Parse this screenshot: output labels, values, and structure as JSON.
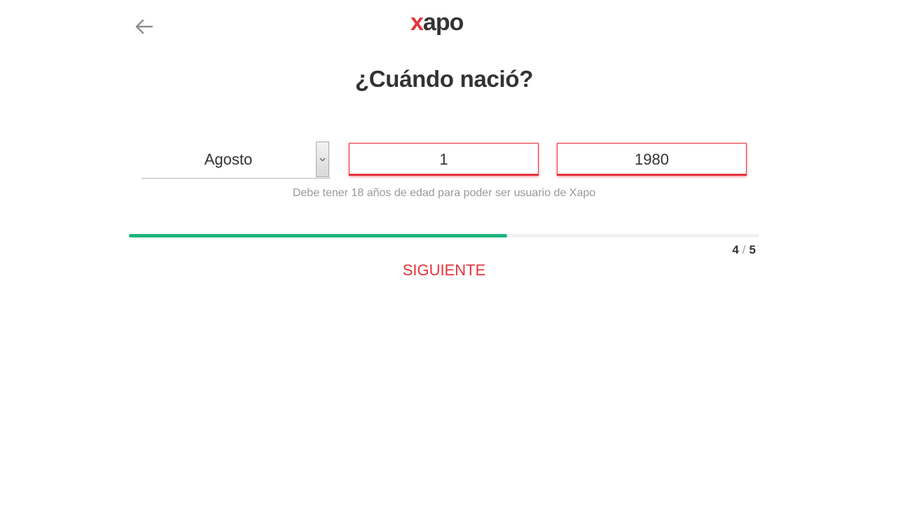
{
  "header": {
    "logo_x": "x",
    "logo_rest": "apo",
    "brand_red": "#e6333a",
    "brand_dark": "#333333"
  },
  "main": {
    "title": "¿Cuándo nació?",
    "month": {
      "selected": "Agosto"
    },
    "day": {
      "value": "1"
    },
    "year": {
      "value": "1980"
    },
    "hint": "Debe tener 18 años de edad para poder ser usuario de Xapo"
  },
  "progress": {
    "current": "4",
    "separator": "/",
    "total": "5",
    "fraction": 0.6,
    "color": "#1db47d"
  },
  "actions": {
    "next_label": "SIGUIENTE"
  }
}
